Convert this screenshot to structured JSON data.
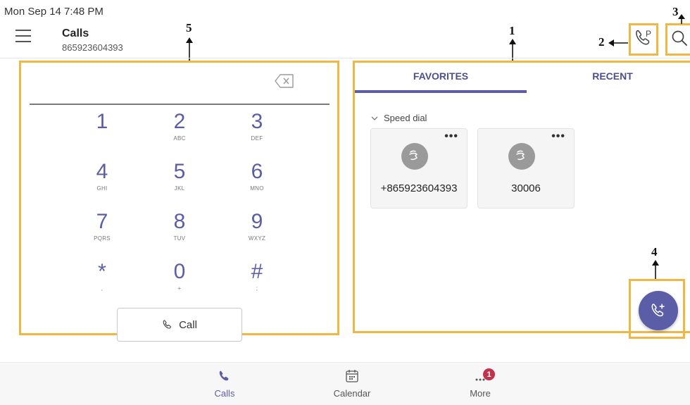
{
  "status_bar": {
    "datetime": "Mon Sep 14  7:48 PM"
  },
  "header": {
    "title": "Calls",
    "subtitle": "865923604393",
    "menu_icon": "hamburger-icon",
    "park_icon": "call-park-icon",
    "search_icon": "search-icon"
  },
  "annotations": [
    "1",
    "2",
    "3",
    "4",
    "5"
  ],
  "dialpad": {
    "keys": [
      {
        "digit": "1",
        "letters": ""
      },
      {
        "digit": "2",
        "letters": "ABC"
      },
      {
        "digit": "3",
        "letters": "DEF"
      },
      {
        "digit": "4",
        "letters": "GHI"
      },
      {
        "digit": "5",
        "letters": "JKL"
      },
      {
        "digit": "6",
        "letters": "MNO"
      },
      {
        "digit": "7",
        "letters": "PQRS"
      },
      {
        "digit": "8",
        "letters": "TUV"
      },
      {
        "digit": "9",
        "letters": "WXYZ"
      },
      {
        "digit": "*",
        "letters": ","
      },
      {
        "digit": "0",
        "letters": "+"
      },
      {
        "digit": "#",
        "letters": ";"
      }
    ],
    "call_label": "Call"
  },
  "tabs": {
    "favorites": "FAVORITES",
    "recent": "RECENT",
    "selected": "FAVORITES"
  },
  "speed_dial": {
    "label": "Speed dial",
    "contacts": [
      {
        "name": "+865923604393",
        "more": "•••"
      },
      {
        "name": "30006",
        "more": "•••"
      }
    ]
  },
  "bottom_nav": {
    "items": [
      {
        "label": "Calls",
        "icon": "phone-icon"
      },
      {
        "label": "Calendar",
        "icon": "calendar-icon"
      },
      {
        "label": "More",
        "icon": "more-icon",
        "badge": "1"
      }
    ]
  },
  "colors": {
    "accent": "#5b5ea6",
    "callout": "#f0b742",
    "badge": "#c4314b"
  }
}
